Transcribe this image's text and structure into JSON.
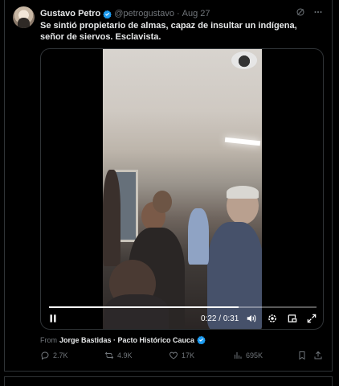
{
  "tweet": {
    "author_name": "Gustavo Petro",
    "handle": "@petrogustavo",
    "separator": "·",
    "date": "Aug 27",
    "text": "Se sintió propietario de almas, capaz de insultar un indígena, señor de siervos. Esclavista.",
    "icons": {
      "verified": "verified-badge-icon",
      "grok": "grok-icon",
      "more": "more-icon"
    }
  },
  "video": {
    "current_time": "0:22",
    "duration": "0:31",
    "time_separator": "/",
    "progress": 0.71,
    "icons": [
      "pause-icon",
      "volume-icon",
      "settings-icon",
      "pip-icon",
      "fullscreen-icon"
    ]
  },
  "source": {
    "prefix": "From",
    "name": "Jorge Bastidas · Pacto Histórico Cauca",
    "verified_icon": "verified-badge-icon"
  },
  "actions": {
    "replies": "2.7K",
    "reposts": "4.9K",
    "likes": "17K",
    "views": "695K",
    "icons": [
      "reply-icon",
      "repost-icon",
      "like-icon",
      "views-icon",
      "bookmark-icon",
      "share-icon"
    ]
  },
  "colors": {
    "background": "#000000",
    "text": "#e7e9ea",
    "muted": "#71767b",
    "verified": "#1d9bf0",
    "border": "#2f3336"
  }
}
